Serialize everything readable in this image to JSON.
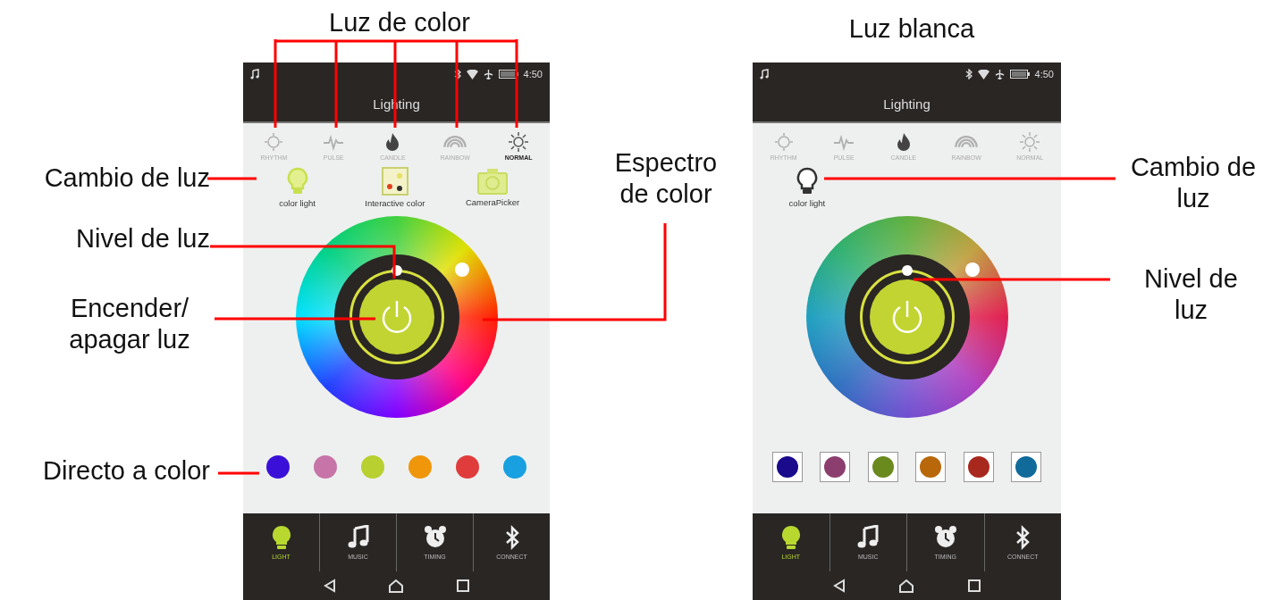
{
  "callouts": [
    {
      "text": "Luz de color"
    },
    {
      "text": "Cambio de luz"
    },
    {
      "text": "Nivel de luz"
    },
    {
      "text": "Encender/ apagar luz"
    },
    {
      "text": "Espectro de color"
    },
    {
      "text": "Directo a color"
    },
    {
      "text": "Luz blanca"
    },
    {
      "text": "Cambio de luz"
    },
    {
      "text": "Nivel de luz"
    }
  ],
  "phones": [
    {
      "status_bar": {
        "time": "4:50"
      },
      "title": "Lighting",
      "color_light_on": true,
      "framed_swatches": false,
      "modes": [
        {
          "label": "RHYTHM",
          "selected": false
        },
        {
          "label": "PULSE",
          "selected": false
        },
        {
          "label": "CANDLE",
          "selected": false
        },
        {
          "label": "RAINBOW",
          "selected": false
        },
        {
          "label": "NORMAL",
          "selected": true
        }
      ],
      "presets": [
        {
          "kind": "bulb",
          "label": "color light"
        },
        {
          "kind": "interactive",
          "label": "Interactive color"
        },
        {
          "kind": "camera",
          "label": "CameraPicker"
        }
      ],
      "brightness": {
        "level": 0.5
      },
      "swatches": [
        {
          "color": "#3a10d8"
        },
        {
          "color": "#c774a8"
        },
        {
          "color": "#b8d030"
        },
        {
          "color": "#f0960a"
        },
        {
          "color": "#e03c3c"
        },
        {
          "color": "#18a0e0"
        }
      ],
      "nav": [
        {
          "label": "LIGHT",
          "selected": true
        },
        {
          "label": "MUSIC",
          "selected": false
        },
        {
          "label": "TIMING",
          "selected": false
        },
        {
          "label": "CONNECT",
          "selected": false
        }
      ]
    },
    {
      "status_bar": {
        "time": "4:50"
      },
      "title": "Lighting",
      "color_light_on": false,
      "framed_swatches": true,
      "modes": [
        {
          "label": "RHYTHM",
          "selected": false
        },
        {
          "label": "PULSE",
          "selected": false
        },
        {
          "label": "CANDLE",
          "selected": false
        },
        {
          "label": "RAINBOW",
          "selected": false
        },
        {
          "label": "NORMAL",
          "selected": false
        }
      ],
      "presets": [
        {
          "kind": "bulb",
          "label": "color light"
        }
      ],
      "brightness": {
        "level": 0.5
      },
      "swatches": [
        {
          "color": "#1a0a8c"
        },
        {
          "color": "#8c3f6e"
        },
        {
          "color": "#6b8a1e"
        },
        {
          "color": "#b8680a"
        },
        {
          "color": "#a8281e"
        },
        {
          "color": "#106a9a"
        }
      ],
      "nav": [
        {
          "label": "LIGHT",
          "selected": true
        },
        {
          "label": "MUSIC",
          "selected": false
        },
        {
          "label": "TIMING",
          "selected": false
        },
        {
          "label": "CONNECT",
          "selected": false
        }
      ]
    }
  ]
}
